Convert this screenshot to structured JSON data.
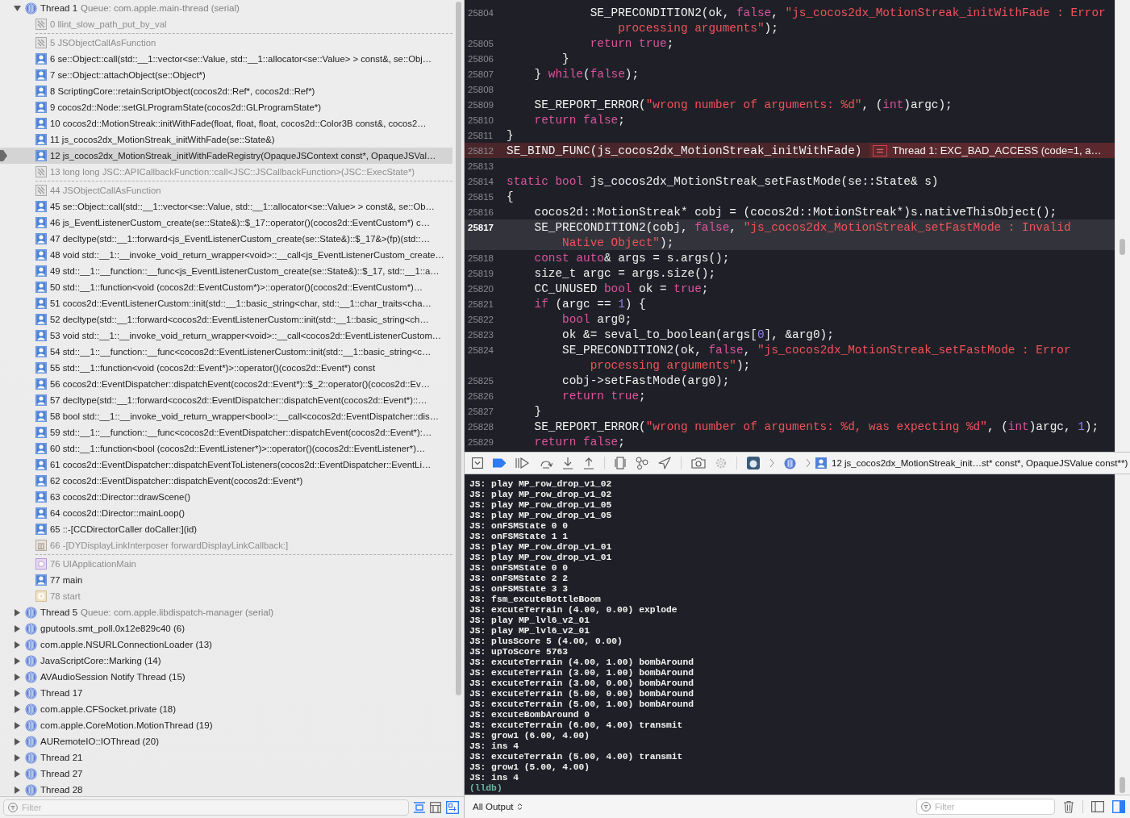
{
  "threads": [
    {
      "name": "Thread 1",
      "queue": "Queue: com.apple.main-thread (serial)",
      "expanded": true,
      "frames": [
        {
          "label": "0 llint_slow_path_put_by_val",
          "kind": "system",
          "selected": false,
          "gap_after": true
        },
        {
          "label": "5 JSObjectCallAsFunction",
          "kind": "system",
          "selected": false,
          "gap_after": false
        },
        {
          "label": "6 se::Object::call(std::__1::vector<se::Value, std::__1::allocator<se::Value> > const&, se::Obj…",
          "kind": "user",
          "selected": false,
          "gap_after": false
        },
        {
          "label": "7 se::Object::attachObject(se::Object*)",
          "kind": "user",
          "selected": false,
          "gap_after": false
        },
        {
          "label": "8 ScriptingCore::retainScriptObject(cocos2d::Ref*, cocos2d::Ref*)",
          "kind": "user",
          "selected": false,
          "gap_after": false
        },
        {
          "label": "9 cocos2d::Node::setGLProgramState(cocos2d::GLProgramState*)",
          "kind": "user",
          "selected": false,
          "gap_after": false
        },
        {
          "label": "10 cocos2d::MotionStreak::initWithFade(float, float, float, cocos2d::Color3B const&, cocos2…",
          "kind": "user",
          "selected": false,
          "gap_after": false
        },
        {
          "label": "11 js_cocos2dx_MotionStreak_initWithFade(se::State&)",
          "kind": "user",
          "selected": false,
          "gap_after": false
        },
        {
          "label": "12 js_cocos2dx_MotionStreak_initWithFadeRegistry(OpaqueJSContext const*, OpaqueJSVal…",
          "kind": "user",
          "selected": true,
          "gap_after": false
        },
        {
          "label": "13 long long JSC::APICallbackFunction::call<JSC::JSCallbackFunction>(JSC::ExecState*)",
          "kind": "system",
          "selected": false,
          "gap_after": true
        },
        {
          "label": "44 JSObjectCallAsFunction",
          "kind": "system",
          "selected": false,
          "gap_after": false
        },
        {
          "label": "45 se::Object::call(std::__1::vector<se::Value, std::__1::allocator<se::Value> > const&, se::Ob…",
          "kind": "user",
          "selected": false,
          "gap_after": false
        },
        {
          "label": "46 js_EventListenerCustom_create(se::State&)::$_17::operator()(cocos2d::EventCustom*) c…",
          "kind": "user",
          "selected": false,
          "gap_after": false
        },
        {
          "label": "47 decltype(std::__1::forward<js_EventListenerCustom_create(se::State&)::$_17&>(fp)(std::…",
          "kind": "user",
          "selected": false,
          "gap_after": false
        },
        {
          "label": "48 void std::__1::__invoke_void_return_wrapper<void>::__call<js_EventListenerCustom_create…",
          "kind": "user",
          "selected": false,
          "gap_after": false
        },
        {
          "label": "49 std::__1::__function::__func<js_EventListenerCustom_create(se::State&)::$_17, std::__1::a…",
          "kind": "user",
          "selected": false,
          "gap_after": false
        },
        {
          "label": "50 std::__1::function<void (cocos2d::EventCustom*)>::operator()(cocos2d::EventCustom*)…",
          "kind": "user",
          "selected": false,
          "gap_after": false
        },
        {
          "label": "51 cocos2d::EventListenerCustom::init(std::__1::basic_string<char, std::__1::char_traits<cha…",
          "kind": "user",
          "selected": false,
          "gap_after": false
        },
        {
          "label": "52 decltype(std::__1::forward<cocos2d::EventListenerCustom::init(std::__1::basic_string<ch…",
          "kind": "user",
          "selected": false,
          "gap_after": false
        },
        {
          "label": "53 void std::__1::__invoke_void_return_wrapper<void>::__call<cocos2d::EventListenerCustom…",
          "kind": "user",
          "selected": false,
          "gap_after": false
        },
        {
          "label": "54 std::__1::__function::__func<cocos2d::EventListenerCustom::init(std::__1::basic_string<c…",
          "kind": "user",
          "selected": false,
          "gap_after": false
        },
        {
          "label": "55 std::__1::function<void (cocos2d::Event*)>::operator()(cocos2d::Event*) const",
          "kind": "user",
          "selected": false,
          "gap_after": false
        },
        {
          "label": "56 cocos2d::EventDispatcher::dispatchEvent(cocos2d::Event*)::$_2::operator()(cocos2d::Ev…",
          "kind": "user",
          "selected": false,
          "gap_after": false
        },
        {
          "label": "57 decltype(std::__1::forward<cocos2d::EventDispatcher::dispatchEvent(cocos2d::Event*)::…",
          "kind": "user",
          "selected": false,
          "gap_after": false
        },
        {
          "label": "58 bool std::__1::__invoke_void_return_wrapper<bool>::__call<cocos2d::EventDispatcher::dis…",
          "kind": "user",
          "selected": false,
          "gap_after": false
        },
        {
          "label": "59 std::__1::__function::__func<cocos2d::EventDispatcher::dispatchEvent(cocos2d::Event*):…",
          "kind": "user",
          "selected": false,
          "gap_after": false
        },
        {
          "label": "60 std::__1::function<bool (cocos2d::EventListener*)>::operator()(cocos2d::EventListener*)…",
          "kind": "user",
          "selected": false,
          "gap_after": false
        },
        {
          "label": "61 cocos2d::EventDispatcher::dispatchEventToListeners(cocos2d::EventDispatcher::EventLi…",
          "kind": "user",
          "selected": false,
          "gap_after": false
        },
        {
          "label": "62 cocos2d::EventDispatcher::dispatchEvent(cocos2d::Event*)",
          "kind": "user",
          "selected": false,
          "gap_after": false
        },
        {
          "label": "63 cocos2d::Director::drawScene()",
          "kind": "user",
          "selected": false,
          "gap_after": false
        },
        {
          "label": "64 cocos2d::Director::mainLoop()",
          "kind": "user",
          "selected": false,
          "gap_after": false
        },
        {
          "label": "65 ::-[CCDirectorCaller doCaller:](id)",
          "kind": "user",
          "selected": false,
          "gap_after": false
        },
        {
          "label": "66 -[DYDisplayLinkInterposer forwardDisplayLinkCallback:]",
          "kind": "framework",
          "selected": false,
          "gap_after": true
        },
        {
          "label": "76 UIApplicationMain",
          "kind": "uikit",
          "selected": false,
          "gap_after": false
        },
        {
          "label": "77 main",
          "kind": "user",
          "selected": false,
          "gap_after": false
        },
        {
          "label": "78 start",
          "kind": "start",
          "selected": false,
          "gap_after": false
        }
      ]
    },
    {
      "name": "Thread 5",
      "queue": "Queue: com.apple.libdispatch-manager (serial)",
      "expanded": false
    },
    {
      "name": "gputools.smt_poll.0x12e829c40 (6)",
      "expanded": false
    },
    {
      "name": "com.apple.NSURLConnectionLoader (13)",
      "expanded": false
    },
    {
      "name": "JavaScriptCore::Marking (14)",
      "expanded": false
    },
    {
      "name": "AVAudioSession Notify Thread (15)",
      "expanded": false
    },
    {
      "name": "Thread 17",
      "expanded": false
    },
    {
      "name": "com.apple.CFSocket.private (18)",
      "expanded": false
    },
    {
      "name": "com.apple.CoreMotion.MotionThread (19)",
      "expanded": false
    },
    {
      "name": "AURemoteIO::IOThread (20)",
      "expanded": false
    },
    {
      "name": "Thread 21",
      "expanded": false
    },
    {
      "name": "Thread 27",
      "expanded": false
    },
    {
      "name": "Thread 28",
      "expanded": false
    }
  ],
  "navigator_filter": {
    "placeholder": "Filter"
  },
  "code": {
    "lines": [
      {
        "number": "25804",
        "current": false,
        "error": false,
        "tokens": [
          {
            "kind": "plain",
            "text": "            SE_PRECONDITION2(ok, "
          },
          {
            "kind": "keyword",
            "text": "false"
          },
          {
            "kind": "plain",
            "text": ", "
          },
          {
            "kind": "string",
            "text": "\"js_cocos2dx_MotionStreak_initWithFade : Error"
          }
        ],
        "wrap": [
          {
            "kind": "string",
            "text": "                processing arguments\""
          },
          {
            "kind": "plain",
            "text": ");"
          }
        ]
      },
      {
        "number": "25805",
        "current": false,
        "error": false,
        "tokens": [
          {
            "kind": "keyword",
            "text": "            return"
          },
          {
            "kind": "keyword",
            "text": " true"
          },
          {
            "kind": "plain",
            "text": ";"
          }
        ]
      },
      {
        "number": "25806",
        "current": false,
        "error": false,
        "tokens": [
          {
            "kind": "plain",
            "text": "        }"
          }
        ]
      },
      {
        "number": "25807",
        "current": false,
        "error": false,
        "tokens": [
          {
            "kind": "plain",
            "text": "    } "
          },
          {
            "kind": "keyword",
            "text": "while"
          },
          {
            "kind": "plain",
            "text": "("
          },
          {
            "kind": "keyword",
            "text": "false"
          },
          {
            "kind": "plain",
            "text": ");"
          }
        ]
      },
      {
        "number": "25808",
        "current": false,
        "error": false
      },
      {
        "number": "25809",
        "current": false,
        "error": false,
        "tokens": [
          {
            "kind": "plain",
            "text": "    SE_REPORT_ERROR("
          },
          {
            "kind": "string",
            "text": "\"wrong number of arguments: %d\""
          },
          {
            "kind": "plain",
            "text": ", ("
          },
          {
            "kind": "keyword",
            "text": "int"
          },
          {
            "kind": "plain",
            "text": ")argc);"
          }
        ]
      },
      {
        "number": "25810",
        "current": false,
        "error": false,
        "tokens": [
          {
            "kind": "keyword",
            "text": "    return"
          },
          {
            "kind": "keyword",
            "text": " false"
          },
          {
            "kind": "plain",
            "text": ";"
          }
        ]
      },
      {
        "number": "25811",
        "current": false,
        "error": false,
        "tokens": [
          {
            "kind": "plain",
            "text": "}"
          }
        ]
      },
      {
        "number": "25812",
        "current": false,
        "error": true,
        "tokens": [
          {
            "kind": "plain",
            "text": "SE_BIND_FUNC(js_cocos2dx_MotionStreak_initWithFade)"
          }
        ],
        "annotation": "Thread 1: EXC_BAD_ACCESS (code=1, a…"
      },
      {
        "number": "25813",
        "current": false,
        "error": false
      },
      {
        "number": "25814",
        "current": false,
        "error": false,
        "tokens": [
          {
            "kind": "keyword",
            "text": "static"
          },
          {
            "kind": "keyword",
            "text": " bool"
          },
          {
            "kind": "plain",
            "text": " js_cocos2dx_MotionStreak_setFastMode(se::State& s)"
          }
        ]
      },
      {
        "number": "25815",
        "current": false,
        "error": false,
        "tokens": [
          {
            "kind": "plain",
            "text": "{"
          }
        ]
      },
      {
        "number": "25816",
        "current": false,
        "error": false,
        "tokens": [
          {
            "kind": "plain",
            "text": "    cocos2d::MotionStreak* cobj = (cocos2d::MotionStreak*)s.nativeThisObject();"
          }
        ]
      },
      {
        "number": "25817",
        "current": true,
        "error": false,
        "tokens": [
          {
            "kind": "plain",
            "text": "    SE_PRECONDITION2(cobj, "
          },
          {
            "kind": "keyword",
            "text": "false"
          },
          {
            "kind": "plain",
            "text": ", "
          },
          {
            "kind": "string",
            "text": "\"js_cocos2dx_MotionStreak_setFastMode : Invalid"
          }
        ],
        "wrap": [
          {
            "kind": "string",
            "text": "        Native Object\""
          },
          {
            "kind": "plain",
            "text": ");"
          }
        ]
      },
      {
        "number": "25818",
        "current": false,
        "error": false,
        "tokens": [
          {
            "kind": "keyword",
            "text": "    const"
          },
          {
            "kind": "keyword",
            "text": " auto"
          },
          {
            "kind": "plain",
            "text": "& args = s.args();"
          }
        ]
      },
      {
        "number": "25819",
        "current": false,
        "error": false,
        "tokens": [
          {
            "kind": "plain",
            "text": "    size_t argc = args.size();"
          }
        ]
      },
      {
        "number": "25820",
        "current": false,
        "error": false,
        "tokens": [
          {
            "kind": "plain",
            "text": "    CC_UNUSED "
          },
          {
            "kind": "keyword",
            "text": "bool"
          },
          {
            "kind": "plain",
            "text": " ok = "
          },
          {
            "kind": "keyword",
            "text": "true"
          },
          {
            "kind": "plain",
            "text": ";"
          }
        ]
      },
      {
        "number": "25821",
        "current": false,
        "error": false,
        "tokens": [
          {
            "kind": "keyword",
            "text": "    if"
          },
          {
            "kind": "plain",
            "text": " (argc == "
          },
          {
            "kind": "number",
            "text": "1"
          },
          {
            "kind": "plain",
            "text": ") {"
          }
        ]
      },
      {
        "number": "25822",
        "current": false,
        "error": false,
        "tokens": [
          {
            "kind": "keyword",
            "text": "        bool"
          },
          {
            "kind": "plain",
            "text": " arg0;"
          }
        ]
      },
      {
        "number": "25823",
        "current": false,
        "error": false,
        "tokens": [
          {
            "kind": "plain",
            "text": "        ok &= seval_to_boolean(args["
          },
          {
            "kind": "number",
            "text": "0"
          },
          {
            "kind": "plain",
            "text": "], &arg0);"
          }
        ]
      },
      {
        "number": "25824",
        "current": false,
        "error": false,
        "tokens": [
          {
            "kind": "plain",
            "text": "        SE_PRECONDITION2(ok, "
          },
          {
            "kind": "keyword",
            "text": "false"
          },
          {
            "kind": "plain",
            "text": ", "
          },
          {
            "kind": "string",
            "text": "\"js_cocos2dx_MotionStreak_setFastMode : Error"
          }
        ],
        "wrap": [
          {
            "kind": "string",
            "text": "            processing arguments\""
          },
          {
            "kind": "plain",
            "text": ");"
          }
        ]
      },
      {
        "number": "25825",
        "current": false,
        "error": false,
        "tokens": [
          {
            "kind": "plain",
            "text": "        cobj->setFastMode(arg0);"
          }
        ]
      },
      {
        "number": "25826",
        "current": false,
        "error": false,
        "tokens": [
          {
            "kind": "keyword",
            "text": "        return"
          },
          {
            "kind": "keyword",
            "text": " true"
          },
          {
            "kind": "plain",
            "text": ";"
          }
        ]
      },
      {
        "number": "25827",
        "current": false,
        "error": false,
        "tokens": [
          {
            "kind": "plain",
            "text": "    }"
          }
        ]
      },
      {
        "number": "25828",
        "current": false,
        "error": false,
        "tokens": [
          {
            "kind": "plain",
            "text": "    SE_REPORT_ERROR("
          },
          {
            "kind": "string",
            "text": "\"wrong number of arguments: %d, was expecting %d\""
          },
          {
            "kind": "plain",
            "text": ", ("
          },
          {
            "kind": "keyword",
            "text": "int"
          },
          {
            "kind": "plain",
            "text": ")argc, "
          },
          {
            "kind": "number",
            "text": "1"
          },
          {
            "kind": "plain",
            "text": ");"
          }
        ]
      },
      {
        "number": "25829",
        "current": false,
        "error": false,
        "tokens": [
          {
            "kind": "keyword",
            "text": "    return"
          },
          {
            "kind": "keyword",
            "text": " false"
          },
          {
            "kind": "plain",
            "text": ";"
          }
        ]
      }
    ]
  },
  "debug_bar": {
    "breakpoints_active": true,
    "breadcrumb": "12 js_cocos2dx_MotionStreak_init…st* const*, OpaqueJSValue const**)"
  },
  "console": {
    "lines": [
      "JS: play MP_row_drop_v1_02",
      "JS: play MP_row_drop_v1_02",
      "JS: play MP_row_drop_v1_05",
      "JS: play MP_row_drop_v1_05",
      "JS: onFSMState 0 0",
      "JS: onFSMState 1 1",
      "JS: play MP_row_drop_v1_01",
      "JS: play MP_row_drop_v1_01",
      "JS: onFSMState 0 0",
      "JS: onFSMState 2 2",
      "JS: onFSMState 3 3",
      "JS: fsm_excuteBottleBoom",
      "JS: excuteTerrain (4.00, 0.00) explode",
      "JS: play MP_lvl6_v2_01",
      "JS: play MP_lvl6_v2_01",
      "JS: plusScore 5 (4.00, 0.00)",
      "JS: upToScore 5763",
      "JS: excuteTerrain (4.00, 1.00) bombAround",
      "JS: excuteTerrain (3.00, 1.00) bombAround",
      "JS: excuteTerrain (3.00, 0.00) bombAround",
      "JS: excuteTerrain (5.00, 0.00) bombAround",
      "JS: excuteTerrain (5.00, 1.00) bombAround",
      "JS: excuteBombAround 0",
      "JS: excuteTerrain (6.00, 4.00) transmit",
      "JS: grow1 (6.00, 4.00)",
      "JS: ins 4",
      "JS: excuteTerrain (5.00, 4.00) transmit",
      "JS: grow1 (5.00, 4.00)",
      "JS: ins 4"
    ],
    "prompt": "(lldb)"
  },
  "console_bar": {
    "output_menu": "All Output",
    "filter_placeholder": "Filter"
  }
}
